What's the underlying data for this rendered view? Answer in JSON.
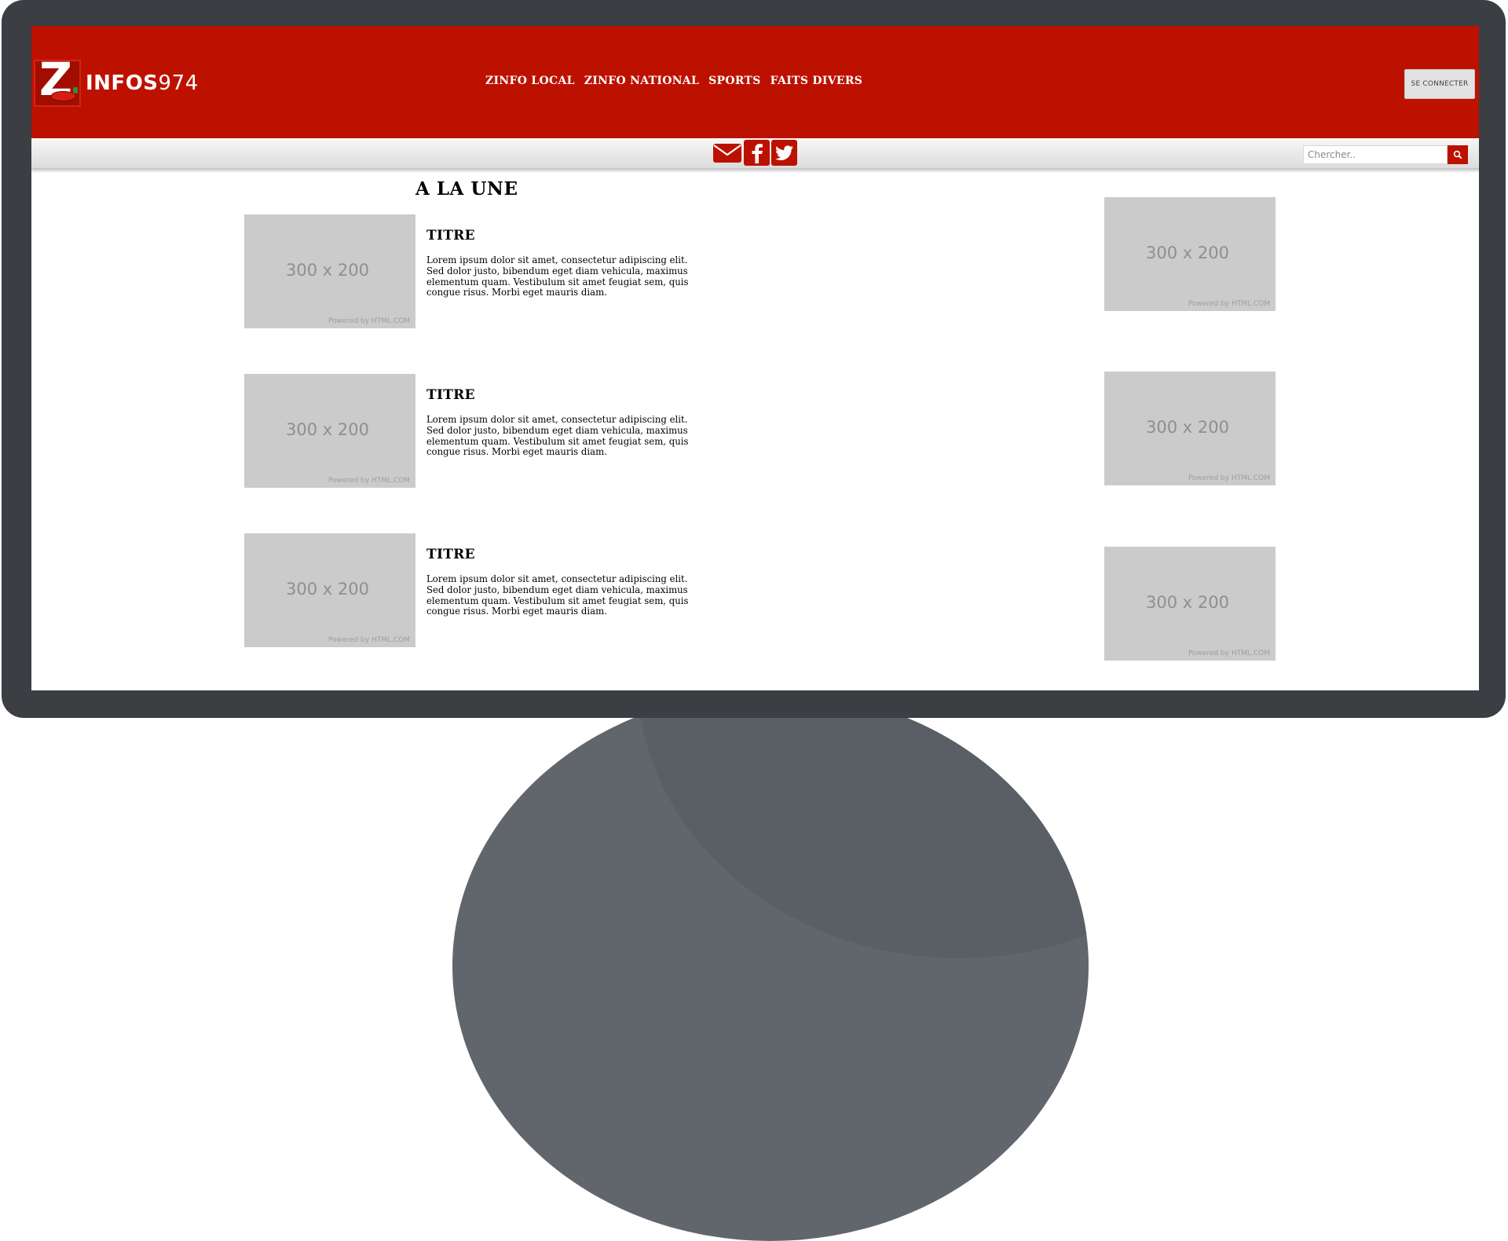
{
  "header": {
    "logo_main": "INFOS",
    "logo_number": "974",
    "nav": [
      "ZINFO LOCAL",
      "ZINFO NATIONAL",
      "SPORTS",
      "FAITS DIVERS"
    ],
    "login_label": "SE CONNECTER"
  },
  "toolbar": {
    "social_icons": [
      "mail-icon",
      "facebook-icon",
      "twitter-icon"
    ],
    "search_placeholder": "Chercher..",
    "search_icon": "search-icon"
  },
  "main": {
    "section_title": "A LA UNE",
    "articles": [
      {
        "title": "TITRE",
        "text": "Lorem ipsum dolor sit amet, consectetur adipiscing elit. Sed dolor justo, bibendum eget diam vehicula, maximus elementum quam. Vestibulum sit amet feugiat sem, quis congue risus. Morbi eget mauris diam.",
        "image_label": "300 x 200",
        "image_credit": "Powered by HTML.COM"
      },
      {
        "title": "TITRE",
        "text": "Lorem ipsum dolor sit amet, consectetur adipiscing elit. Sed dolor justo, bibendum eget diam vehicula, maximus elementum quam. Vestibulum sit amet feugiat sem, quis congue risus. Morbi eget mauris diam.",
        "image_label": "300 x 200",
        "image_credit": "Powered by HTML.COM"
      },
      {
        "title": "TITRE",
        "text": "Lorem ipsum dolor sit amet, consectetur adipiscing elit. Sed dolor justo, bibendum eget diam vehicula, maximus elementum quam. Vestibulum sit amet feugiat sem, quis congue risus. Morbi eget mauris diam.",
        "image_label": "300 x 200",
        "image_credit": "Powered by HTML.COM"
      }
    ],
    "side_images": [
      {
        "label": "300 x 200",
        "credit": "Powered by HTML.COM"
      },
      {
        "label": "300 x 200",
        "credit": "Powered by HTML.COM"
      },
      {
        "label": "300 x 200",
        "credit": "Powered by HTML.COM"
      }
    ]
  },
  "colors": {
    "brand_red": "#bd1100",
    "bezel": "#3b3e42",
    "stand": "#61656c",
    "placeholder_bg": "#cbcbcb"
  }
}
